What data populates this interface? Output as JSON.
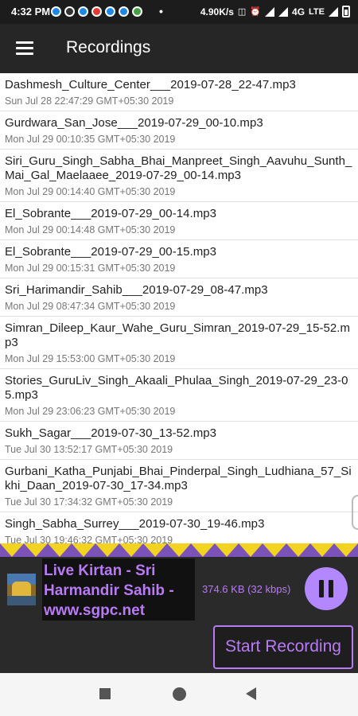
{
  "status_bar": {
    "time": "4:32 PM",
    "more_indicator": "•",
    "net_speed": "4.90K/s",
    "network": "4G",
    "volte": "LTE"
  },
  "app_bar": {
    "title": "Recordings"
  },
  "recordings": [
    {
      "name": "Dashmesh_Culture_Center___2019-07-28_22-47.mp3",
      "date": "Sun Jul 28 22:47:29 GMT+05:30 2019"
    },
    {
      "name": "Gurdwara_San_Jose___2019-07-29_00-10.mp3",
      "date": "Mon Jul 29 00:10:35 GMT+05:30 2019"
    },
    {
      "name": "Siri_Guru_Singh_Sabha_Bhai_Manpreet_Singh_Aavuhu_Sunth_Mai_Gal_Maelaaee_2019-07-29_00-14.mp3",
      "date": "Mon Jul 29 00:14:40 GMT+05:30 2019"
    },
    {
      "name": "El_Sobrante___2019-07-29_00-14.mp3",
      "date": "Mon Jul 29 00:14:48 GMT+05:30 2019"
    },
    {
      "name": "El_Sobrante___2019-07-29_00-15.mp3",
      "date": "Mon Jul 29 00:15:31 GMT+05:30 2019"
    },
    {
      "name": "Sri_Harimandir_Sahib___2019-07-29_08-47.mp3",
      "date": "Mon Jul 29 08:47:34 GMT+05:30 2019"
    },
    {
      "name": "Simran_Dileep_Kaur_Wahe_Guru_Simran_2019-07-29_15-52.mp3",
      "date": "Mon Jul 29 15:53:00 GMT+05:30 2019"
    },
    {
      "name": "Stories_GuruLiv_Singh_Akaali_Phulaa_Singh_2019-07-29_23-05.mp3",
      "date": "Mon Jul 29 23:06:23 GMT+05:30 2019"
    },
    {
      "name": "Sukh_Sagar___2019-07-30_13-52.mp3",
      "date": "Tue Jul 30 13:52:17 GMT+05:30 2019"
    },
    {
      "name": "Gurbani_Katha_Punjabi_Bhai_Pinderpal_Singh_Ludhiana_57_Sikhi_Daan_2019-07-30_17-34.mp3",
      "date": "Tue Jul 30 17:34:32 GMT+05:30 2019"
    },
    {
      "name": "Singh_Sabha_Surrey___2019-07-30_19-46.mp3",
      "date": "Tue Jul 30 19:46:32 GMT+05:30 2019"
    }
  ],
  "player": {
    "station_title": "Live Kirtan - Sri\nHarmandir Sahib -\nwww.sgpc.net",
    "bitrate": "374.6 KB (32 kbps)",
    "start_recording_label": "Start Recording"
  },
  "colors": {
    "accent": "#b97af5",
    "pause_button": "#b388ff",
    "zigzag_yellow": "#f2d321",
    "zigzag_purple": "#7a52b8",
    "app_bar": "#262626"
  }
}
